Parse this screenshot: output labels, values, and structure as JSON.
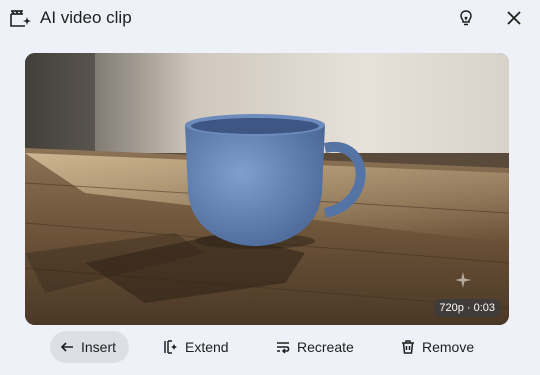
{
  "header": {
    "title": "AI video clip",
    "icons": [
      "clip-sparkle-icon",
      "lightbulb-icon",
      "close-icon"
    ]
  },
  "preview": {
    "badge": "720p · 0:03",
    "description_icon": "sparkle-icon"
  },
  "actions": {
    "insert": "Insert",
    "extend": "Extend",
    "recreate": "Recreate",
    "remove": "Remove"
  },
  "colors": {
    "background": "#eef1f7",
    "selected_action_bg": "#dcdfe5",
    "text": "#1f1f1f"
  }
}
